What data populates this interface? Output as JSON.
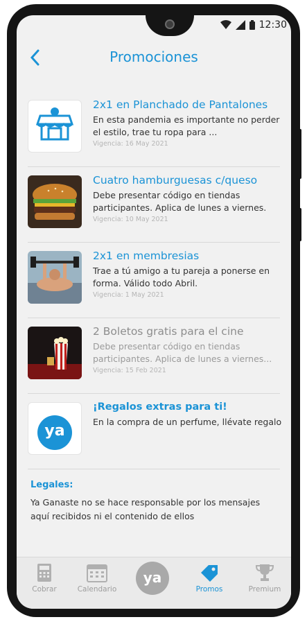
{
  "status_bar": {
    "time": "12:30"
  },
  "header": {
    "title": "Promociones"
  },
  "promos": [
    {
      "title": "2x1 en Planchado de Pantalones",
      "description": "En esta pandemia es importante no perder el estilo, trae tu ropa para ...",
      "date": "Vigencia: 16 May 2021",
      "thumb": "store-icon",
      "active": true
    },
    {
      "title": "Cuatro hamburguesas c/queso",
      "description": "Debe presentar código en tiendas participantes. Aplica de lunes a viernes.",
      "date": "Vigencia: 10 May 2021",
      "thumb": "burger-image",
      "active": true
    },
    {
      "title": "2x1 en membresias",
      "description": "Trae a tú amigo a tu pareja a ponerse en forma. Válido todo Abril.",
      "date": "Vigencia: 1 May 2021",
      "thumb": "gym-image",
      "active": true
    },
    {
      "title": "2 Boletos gratis para el cine",
      "description": "Debe presentar código en tiendas participantes. Aplica de lunes a viernes...",
      "date": "Vigencia: 15 Feb 2021",
      "thumb": "cinema-image",
      "active": false
    },
    {
      "title": "¡Regalos extras para ti!",
      "description": "En la compra de un perfume, llévate regalo",
      "date": "",
      "thumb": "ya-logo",
      "active": true
    }
  ],
  "ya_logo_text": "ya",
  "legal": {
    "title": "Legales:",
    "text": "Ya Ganaste no se hace responsable por los mensajes aquí recibidos ni el contenido de ellos"
  },
  "tabs": [
    {
      "label": "Cobrar",
      "icon": "calculator-icon"
    },
    {
      "label": "Calendario",
      "icon": "calendar-icon"
    },
    {
      "label": "",
      "icon": "ya-logo"
    },
    {
      "label": "Promos",
      "icon": "tag-icon",
      "active": true
    },
    {
      "label": "Premium",
      "icon": "trophy-icon"
    }
  ],
  "colors": {
    "accent": "#1b93d6",
    "inactive": "#9d9d9d",
    "background": "#f1f1f1"
  }
}
